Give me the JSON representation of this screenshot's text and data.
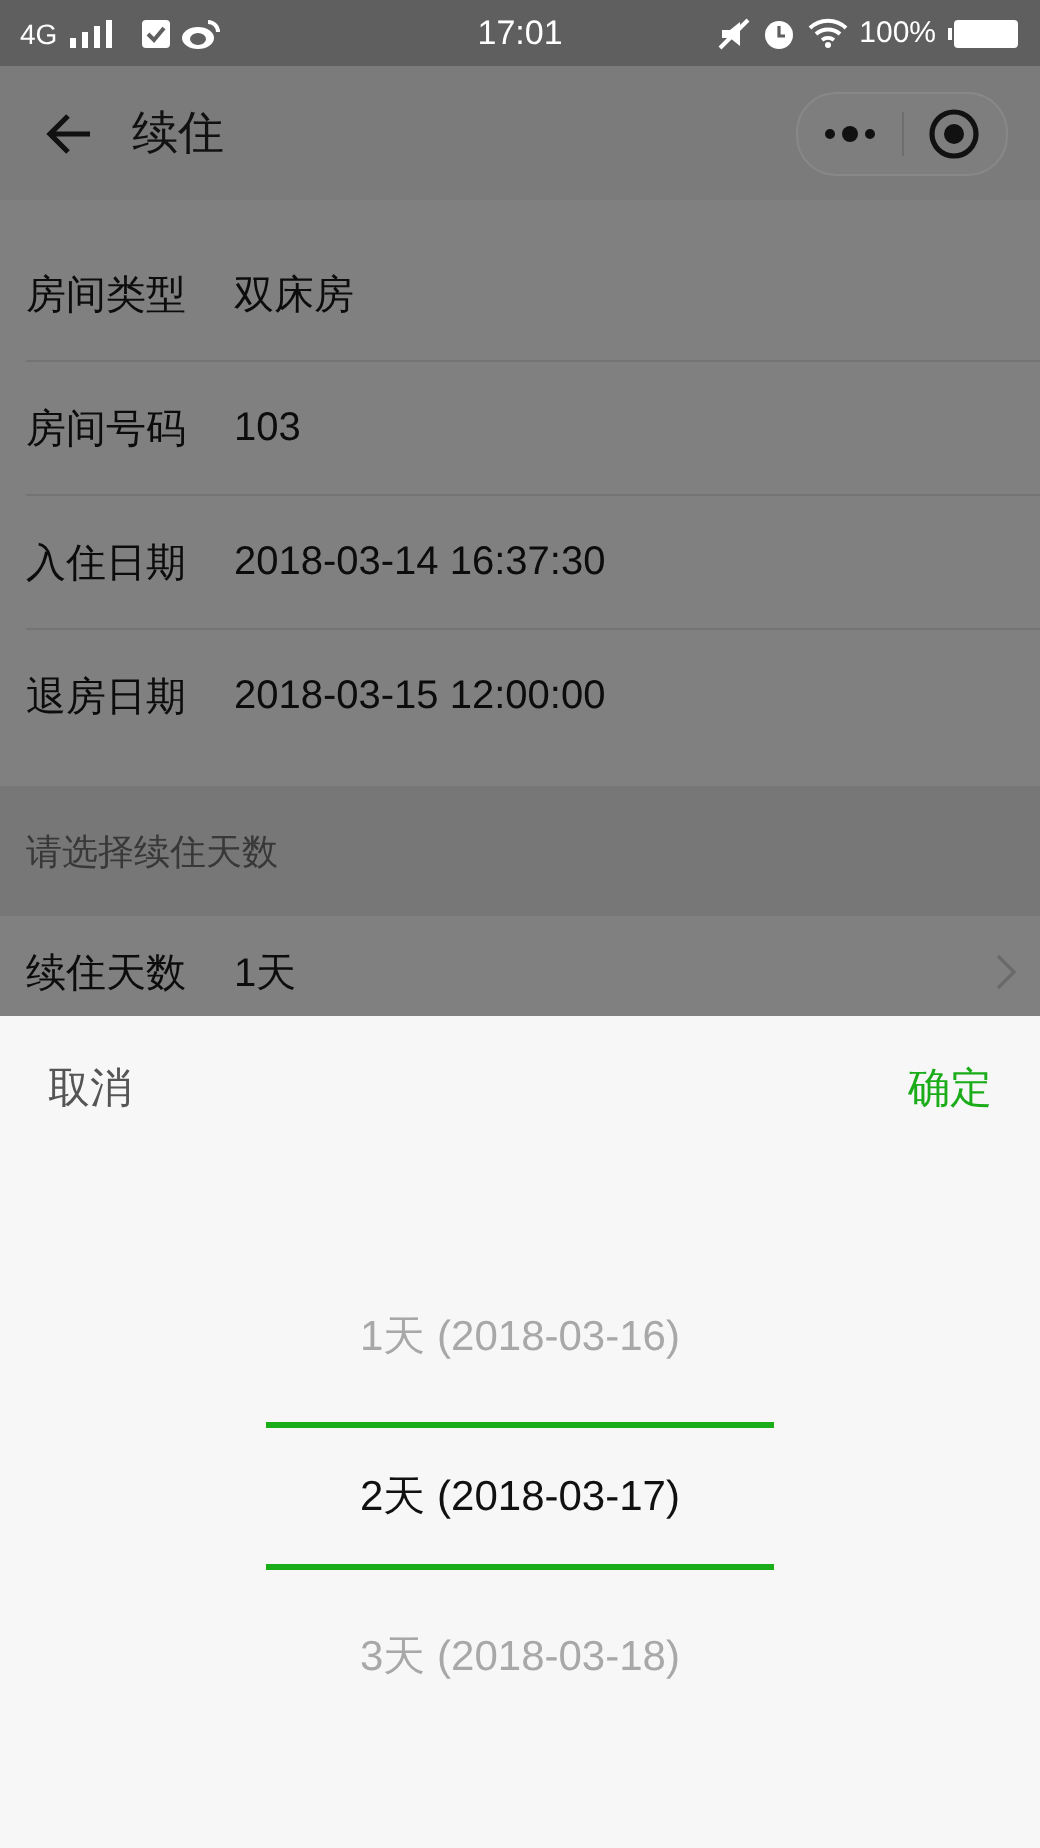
{
  "status_bar": {
    "network": "4G",
    "time": "17:01",
    "battery": "100%"
  },
  "nav": {
    "title": "续住"
  },
  "info_rows": [
    {
      "label": "房间类型",
      "value": "双床房"
    },
    {
      "label": "房间号码",
      "value": "103"
    },
    {
      "label": "入住日期",
      "value": "2018-03-14 16:37:30"
    },
    {
      "label": "退房日期",
      "value": "2018-03-15 12:00:00"
    }
  ],
  "section_header": "请选择续住天数",
  "stay_row": {
    "label": "续住天数",
    "value": "1天"
  },
  "picker": {
    "cancel": "取消",
    "confirm": "确定",
    "options": [
      {
        "label": "1天 (2018-03-16)",
        "selected": false
      },
      {
        "label": "2天 (2018-03-17)",
        "selected": true
      },
      {
        "label": "3天 (2018-03-18)",
        "selected": false
      }
    ]
  }
}
